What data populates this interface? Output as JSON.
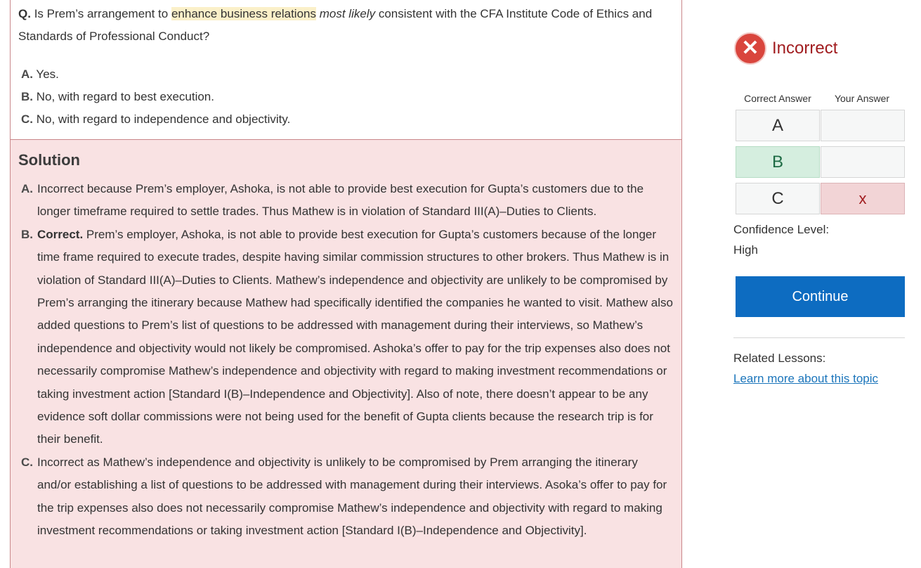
{
  "question": {
    "label": "Q.",
    "text_before": "Is Prem’s arrangement to",
    "highlight": "enhance business relations",
    "emphasis": "most likely",
    "text_after": "consistent with the CFA Institute Code of Ethics and Standards of Professional Conduct?",
    "options": [
      {
        "letter": "A.",
        "text": "Yes."
      },
      {
        "letter": "B.",
        "text": "No, with regard to best execution."
      },
      {
        "letter": "C.",
        "text": "No, with regard to independence and objectivity."
      }
    ]
  },
  "solution": {
    "title": "Solution",
    "items": [
      {
        "letter": "A.",
        "prefix": "",
        "text": "Incorrect because Prem’s employer, Ashoka, is not able to provide best execution for Gupta’s customers due to the longer timeframe required to settle trades. Thus Mathew is in violation of Standard III(A)–Duties to Clients."
      },
      {
        "letter": "B.",
        "prefix": "Correct.",
        "text": "Prem’s employer, Ashoka, is not able to provide best execution for Gupta’s customers because of the longer time frame required to execute trades, despite having similar commission structures to other brokers. Thus Mathew is in violation of Standard III(A)–Duties to Clients. Mathew’s independence and objectivity are unlikely to be compromised by Prem’s arranging the itinerary because Mathew had specifically identified the companies he wanted to visit. Mathew also added questions to Prem’s list of questions to be addressed with management during their interviews, so Mathew’s independence and objectivity would not likely be compromised. Ashoka’s offer to pay for the trip expenses also does not necessarily compromise Mathew’s independence and objectivity with regard to making investment recommendations or taking investment action [Standard I(B)–Independence and Objectivity]. Also of note, there doesn’t appear to be any evidence soft dollar commissions were not being used for the benefit of Gupta clients because the research trip is for their benefit."
      },
      {
        "letter": "C.",
        "prefix": "",
        "text": "Incorrect as Mathew’s independence and objectivity is unlikely to be compromised by Prem arranging the itinerary and/or establishing a list of questions to be addressed with management during their interviews. Asoka’s offer to pay for the trip expenses also does not necessarily compromise Mathew’s independence and objectivity with regard to making investment recommendations or taking investment action [Standard I(B)–Independence and Objectivity]."
      }
    ]
  },
  "result": {
    "status_icon": "x-circle-icon",
    "status_label": "Incorrect",
    "status_color": "#d9453d",
    "correct_answer_header": "Correct Answer",
    "your_answer_header": "Your Answer",
    "rows": [
      {
        "letter": "A",
        "your_mark": ""
      },
      {
        "letter": "B",
        "your_mark": ""
      },
      {
        "letter": "C",
        "your_mark": "x"
      }
    ],
    "correct_letter": "B",
    "selected_letter": "C",
    "confidence_label": "Confidence Level:",
    "confidence_value": "High",
    "continue_label": "Continue",
    "continue_color": "#0d6cc1",
    "related_label": "Related Lessons:",
    "related_link": "Learn more about this topic"
  }
}
